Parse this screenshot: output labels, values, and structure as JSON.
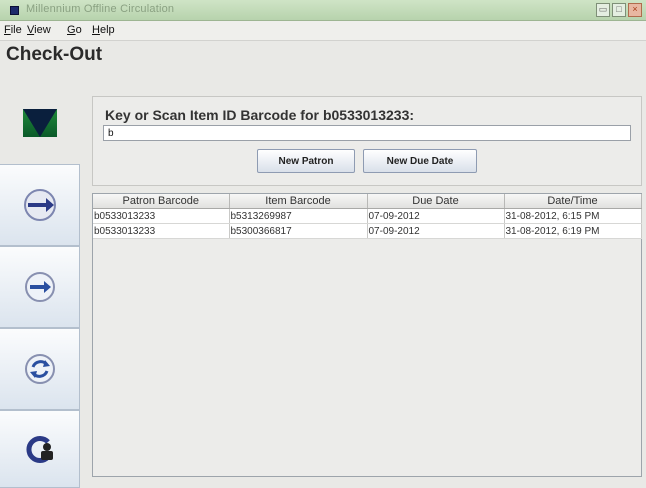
{
  "window": {
    "title": "Millennium Offline Circulation",
    "controls": [
      "restore",
      "maximize",
      "close"
    ]
  },
  "menu": [
    "File",
    "View",
    "Go",
    "Help"
  ],
  "page_title": "Check-Out",
  "left_rail": [
    "logo-icon",
    "checkout-icon",
    "checkin-icon",
    "renew-icon",
    "patron-icon"
  ],
  "scan_panel": {
    "prompt_prefix": "Key or Scan Item ID Barcode for",
    "patron_barcode": "b0533013233:",
    "input_value": "b",
    "new_patron_label": "New Patron",
    "new_due_date_label": "New Due Date"
  },
  "table": {
    "columns": [
      "Patron Barcode",
      "Item Barcode",
      "Due Date",
      "Date/Time"
    ],
    "rows": [
      [
        "b0533013233",
        "b5313269987",
        "07-09-2012",
        "31-08-2012, 6:15 PM"
      ],
      [
        "b0533013233",
        "b5300366817",
        "07-09-2012",
        "31-08-2012, 6:19 PM"
      ]
    ]
  },
  "colors": {
    "accent_arrow": "#2b3a86",
    "logo_green": "#1c7a2c",
    "title_green": "#b7d3ad"
  }
}
